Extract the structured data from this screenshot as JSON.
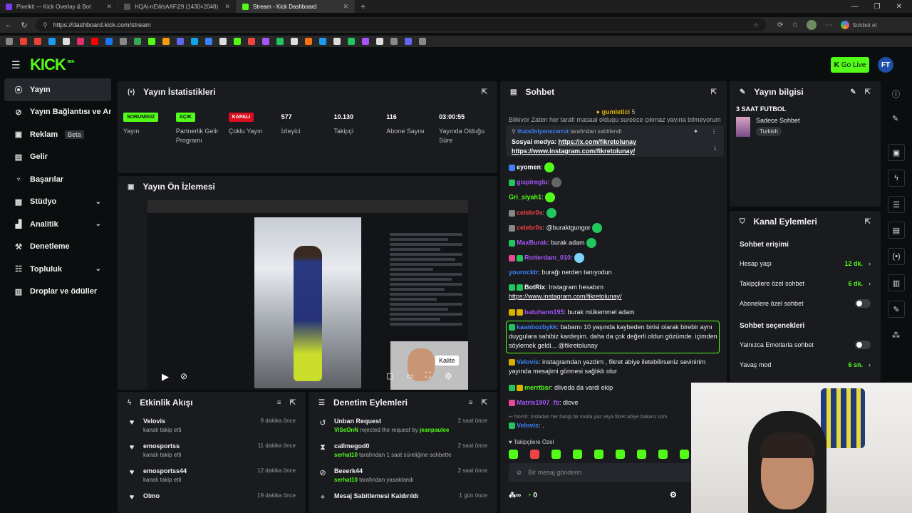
{
  "browser": {
    "tabs": [
      {
        "title": "Pixelkit — Kick Overlay & Bot",
        "color": "#7c3aed"
      },
      {
        "title": "HQAi-nEWsAAFi29 (1430×2048)",
        "color": "#555555"
      },
      {
        "title": "Stream - Kick Dashboard",
        "color": "#53fc18"
      }
    ],
    "url": "https://dashboard.kick.com/stream",
    "copilot_label": "Sohbet et"
  },
  "header": {
    "logo": "KICK",
    "logo_sup": "BETA",
    "go_live": "Go Live",
    "user_initials": "FT"
  },
  "sidebar": {
    "items": [
      {
        "label": "Yayın",
        "icon": "broadcast-icon"
      },
      {
        "label": "Yayın Bağlantısı ve Anahtarı",
        "icon": "link-icon"
      },
      {
        "label": "Reklam",
        "icon": "ad-icon",
        "badge": "Beta"
      },
      {
        "label": "Gelir",
        "icon": "wallet-icon"
      },
      {
        "label": "Başarılar",
        "icon": "trophy-icon"
      },
      {
        "label": "Stüdyo",
        "icon": "studio-icon"
      },
      {
        "label": "Analitik",
        "icon": "chart-icon"
      },
      {
        "label": "Denetleme",
        "icon": "hammer-icon"
      },
      {
        "label": "Topluluk",
        "icon": "community-icon"
      },
      {
        "label": "Droplar ve ödüller",
        "icon": "gift-icon"
      }
    ]
  },
  "stats": {
    "title": "Yayın İstatistikleri",
    "items": [
      {
        "pill": "SORUNSUZ",
        "pill_color": "green",
        "label": "Yayın"
      },
      {
        "pill": "AÇIK",
        "pill_color": "green",
        "label": "Partnerlik Gelir Programı"
      },
      {
        "pill": "KAPALI",
        "pill_color": "red",
        "label": "Çoklu Yayın"
      },
      {
        "value": "577",
        "label": "İzleyici"
      },
      {
        "value": "10.130",
        "label": "Takipçi"
      },
      {
        "value": "116",
        "label": "Abone Sayısı"
      },
      {
        "value": "03:00:55",
        "label": "Yayında Olduğu Süre"
      }
    ]
  },
  "preview": {
    "title": "Yayın Ön İzlemesi",
    "quality_tooltip": "Kalite"
  },
  "activity": {
    "title": "Etkinlik Akışı",
    "items": [
      {
        "name": "Velovis",
        "desc": "kanalı takip etti",
        "time": "9 dakika önce"
      },
      {
        "name": "emosportss",
        "desc": "kanalı takip etti",
        "time": "11 dakika önce"
      },
      {
        "name": "emosportss44",
        "desc": "kanalı takip etti",
        "time": "12 dakika önce"
      },
      {
        "name": "Olmo",
        "desc": "",
        "time": "19 dakika önce"
      }
    ]
  },
  "moderation": {
    "title": "Denetim Eylemleri",
    "items": [
      {
        "title": "Unban Request",
        "actor": "ViSeOnN",
        "desc": " rejected the request by ",
        "target": "jeanpaulee",
        "time": "2 saat önce"
      },
      {
        "title": "callmegod0",
        "actor": "serhat10",
        "desc": " tarafından 1 saat süreliğine sohbetten uzaklaştırıldı",
        "target": "",
        "time": "2 saat önce"
      },
      {
        "title": "Beeerk44",
        "actor": "serhat10",
        "desc": " tarafından yasaklandı",
        "target": "",
        "time": "2 saat önce"
      },
      {
        "title": "Mesaj Sabitlemesi Kaldırıldı",
        "actor": "",
        "desc": "",
        "target": "",
        "time": "1 gün önce"
      }
    ]
  },
  "chat": {
    "title": "Sohbet",
    "top_partial": "Bilkiyor Zaten her tarafı masaal oldugu sureece çıkmaz yayına bilmeyorum",
    "gift_user": "gumletici",
    "gift_count": "5",
    "pinned_by_user": "thats0nlyonecarrot",
    "pinned_by_suffix": " tarafından sabitlendi",
    "pinned_msg_prefix": "Sosyal medya: ",
    "pinned_link1": "https://x.com/fikretolunay",
    "pinned_link2": "https://www.instagram.com/fikretolunay/",
    "messages": [
      {
        "user": "eyomen",
        "color": "#ffffff",
        "text": ""
      },
      {
        "user": "gispiroglu",
        "color": "#a855f7",
        "text": ""
      },
      {
        "user": "Gri_siyah1",
        "color": "#53fc18",
        "text": ""
      },
      {
        "user": "celebr0s",
        "color": "#ef4444",
        "text": ""
      },
      {
        "user": "celebr0s",
        "color": "#ef4444",
        "text": "@buraktgungor"
      },
      {
        "user": "MaxBurak",
        "color": "#a855f7",
        "text": "burak adam"
      },
      {
        "user": "Rotterdam_010",
        "color": "#a855f7",
        "text": ""
      },
      {
        "user": "yourocktr",
        "color": "#3b82f6",
        "text": "burağı nerden tanıyodun"
      },
      {
        "user": "BotRix",
        "color": "#ffffff",
        "text": "Instagram hesabım"
      },
      {
        "user": "batuhann195",
        "color": "#a855f7",
        "text": "burak mükemmel adam"
      },
      {
        "user": "kaanbozbykk",
        "color": "#3b82f6",
        "text": "babamı 10 yaşında kaybeden birisi olarak birebir aynı duygulara sahibiz kardeşim. daha da çok değerli oldun gözümde. içimden söylemek geldi... @fikretolunay"
      },
      {
        "user": "Velovis",
        "color": "#3b82f6",
        "text": "instagramdan yazdım , fikret abiye iletebilirseniz sevinirim yayında mesajimi görmesi sağlıklı olur"
      },
      {
        "user": "merrtbsr",
        "color": "#53fc18",
        "text": "dliveda da vardi ekip"
      },
      {
        "user": "Matrix1907_fb",
        "color": "#a855f7",
        "text": "dlove"
      },
      {
        "user": "Velovis",
        "color": "#3b82f6",
        "text": "."
      }
    ],
    "botrix_link": "https://www.instagram.com/fikretolunay/",
    "deleted_note": "Nors0: İnstadan her hangi bir moda yaz veya fikret abiye bakarız isim",
    "followers_only": "Takipçilere Özel",
    "input_placeholder": "Bir mesaj gönderin",
    "viewer_count": "0"
  },
  "stream_info": {
    "title": "Yayın bilgisi",
    "stream_title": "3 SAAT FUTBOL",
    "category": "Sadece Sohbet",
    "language": "Turkish"
  },
  "channel": {
    "title": "Kanal Eylemleri",
    "chat_access": "Sohbet erişimi",
    "account_age_label": "Hesap yaşı",
    "account_age_value": "12 dk.",
    "followers_chat_label": "Takipçilere özel sohbet",
    "followers_chat_value": "6 dk.",
    "subs_chat_label": "Abonelere özel sohbet",
    "chat_options": "Sohbet seçenekleri",
    "emotes_only_label": "Yalnızca Emotlarla sohbet",
    "slow_mode_label": "Yavaş mod",
    "slow_mode_value": "6 sn."
  }
}
